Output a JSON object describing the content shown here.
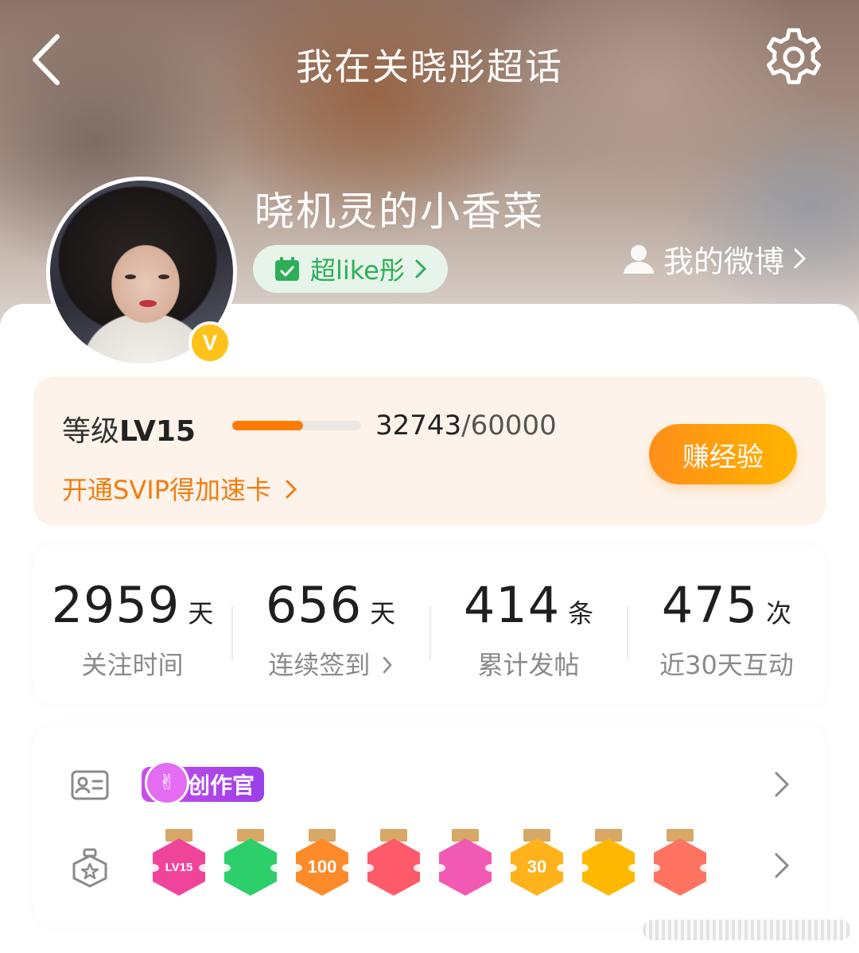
{
  "header": {
    "title": "我在关晓彤超话"
  },
  "profile": {
    "username": "晓机灵的小香菜",
    "super_like_label": "超like彤",
    "my_weibo_label": "我的微博"
  },
  "level": {
    "label": "等级",
    "level_value": "LV15",
    "exp_current": "32743",
    "exp_total": "/60000",
    "progress_fraction": 0.55,
    "svip_link": "开通SVIP得加速卡",
    "earn_button": "赚经验"
  },
  "stats": [
    {
      "value": "2959",
      "unit": "天",
      "label": "关注时间"
    },
    {
      "value": "656",
      "unit": "天",
      "label": "连续签到"
    },
    {
      "value": "414",
      "unit": "条",
      "label": "累计发帖"
    },
    {
      "value": "475",
      "unit": "次",
      "label": "近30天互动"
    }
  ],
  "badges": {
    "creator_tag": "创作官",
    "medals": [
      {
        "name": "lv15-medal",
        "text": "LV15",
        "color": "#f0449a"
      },
      {
        "name": "hand-medal",
        "text": "",
        "color": "#2ccf6a"
      },
      {
        "name": "100-days-medal",
        "text": "100",
        "color": "#ff8a2a"
      },
      {
        "name": "trophy-medal",
        "text": "",
        "color": "#ff5a6a"
      },
      {
        "name": "graduation-medal",
        "text": "",
        "color": "#f259b4"
      },
      {
        "name": "30-days-medal",
        "text": "30",
        "color": "#ffb21a"
      },
      {
        "name": "emoji-medal",
        "text": "",
        "color": "#ffb800"
      },
      {
        "name": "rock-hand-medal",
        "text": "",
        "color": "#ff7360"
      }
    ]
  },
  "colors": {
    "accent_orange": "#ff7a00",
    "green": "#2fae58"
  }
}
